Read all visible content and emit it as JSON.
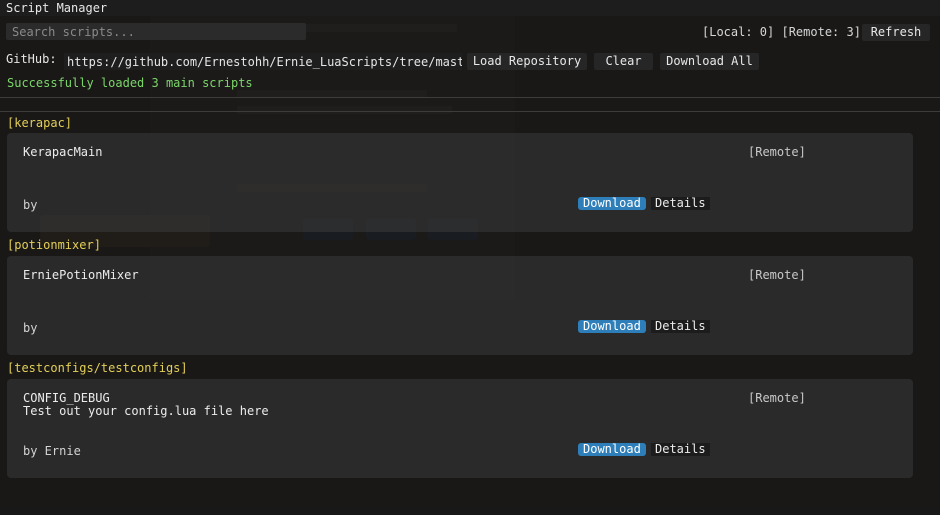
{
  "window": {
    "title": "Script Manager"
  },
  "search": {
    "placeholder": "Search scripts..."
  },
  "counts": {
    "local_text": "[Local: 0]",
    "remote_text": "[Remote: 3]"
  },
  "toolbar": {
    "refresh_label": "Refresh"
  },
  "github": {
    "label": "GitHub:",
    "url": "https://github.com/Ernestohh/Ernie_LuaScripts/tree/master",
    "load_label": "Load Repository",
    "clear_label": "Clear",
    "download_all_label": "Download All"
  },
  "status": {
    "message": "Successfully loaded 3 main scripts"
  },
  "sections": [
    {
      "header": "[kerapac]",
      "script": {
        "name": "KerapacMain",
        "description": "",
        "tag": "[Remote]",
        "author": "by",
        "download_label": "Download",
        "details_label": "Details"
      }
    },
    {
      "header": "[potionmixer]",
      "script": {
        "name": "ErniePotionMixer",
        "description": "",
        "tag": "[Remote]",
        "author": "by",
        "download_label": "Download",
        "details_label": "Details"
      }
    },
    {
      "header": "[testconfigs/testconfigs]",
      "script": {
        "name": "CONFIG_DEBUG",
        "description": "Test out your config.lua file here",
        "tag": "[Remote]",
        "author": "by Ernie",
        "download_label": "Download",
        "details_label": "Details"
      }
    }
  ],
  "colors": {
    "accent_download": "#2e7fb9",
    "section_header": "#e3cf57",
    "status_success": "#7cd66a"
  }
}
